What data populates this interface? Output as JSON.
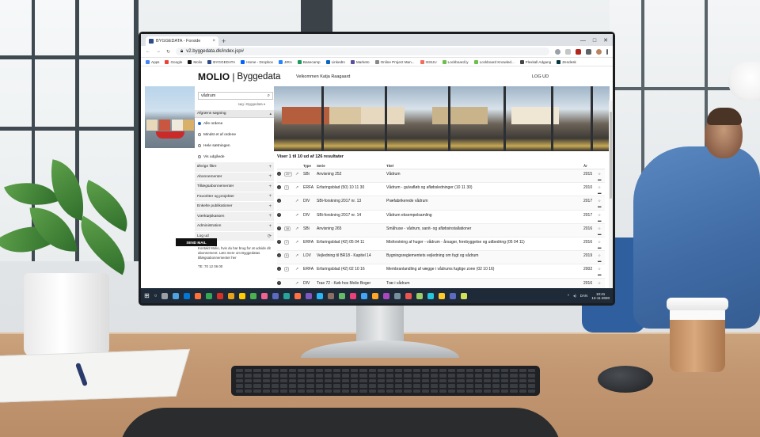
{
  "browser": {
    "tab_title": "BYGGEDATA - Forside",
    "tab_close": "×",
    "new_tab": "+",
    "window_controls": [
      "—",
      "□",
      "✕"
    ],
    "url": "v2.byggedata.dk/index.jsp#",
    "nav": {
      "back": "←",
      "forward": "→",
      "reload": "↻"
    },
    "bookmarks": [
      {
        "label": "Apps",
        "color": "#4285f4"
      },
      {
        "label": "Google",
        "color": "#ea4335"
      },
      {
        "label": "Molio",
        "color": "#111111"
      },
      {
        "label": "BYGGEDATA",
        "color": "#2d4a8a"
      },
      {
        "label": "Home - Dropbox",
        "color": "#0061fe"
      },
      {
        "label": "JIRA",
        "color": "#2684ff"
      },
      {
        "label": "Basecamp",
        "color": "#1d9a5a"
      },
      {
        "label": "LinkedIn",
        "color": "#0a66c2"
      },
      {
        "label": "Marketo",
        "color": "#5c4c9f"
      },
      {
        "label": "Online Project Man...",
        "color": "#888888"
      },
      {
        "label": "ISSUU",
        "color": "#f36d5d"
      },
      {
        "label": "Lockboard.ly",
        "color": "#6dbf4b"
      },
      {
        "label": "Lockboard Knowled...",
        "color": "#6dbf4b"
      },
      {
        "label": "Flexkall Adgang",
        "color": "#444444"
      },
      {
        "label": "Zendesk",
        "color": "#03363d"
      }
    ]
  },
  "site": {
    "logo": "MOLIO",
    "logo_sep": "|",
    "logo_sub": "Byggedata",
    "welcome": "Velkommen Katja Raagaard",
    "logout": "LOG UD"
  },
  "search": {
    "value": "vådrum",
    "icon": "search-icon",
    "hint": "søg i Byggedata  ▾"
  },
  "sidebar": {
    "filter_head": "Afgræns søgning",
    "radios": [
      {
        "label": "Alle ordene",
        "checked": true
      },
      {
        "label": "Mindst et af ordene",
        "checked": false
      },
      {
        "label": "Hele sætningen",
        "checked": false
      },
      {
        "label": "Vis udgåede",
        "checked": false
      }
    ],
    "items": [
      {
        "label": "Øvrige filtre",
        "icon": "+"
      },
      {
        "label": "Abonnementer",
        "icon": "+"
      },
      {
        "label": "Tillægsabonnementer",
        "icon": "+"
      },
      {
        "label": "Favoritter og projekter",
        "icon": "+"
      },
      {
        "label": "Enkelte publikationer",
        "icon": "+"
      },
      {
        "label": "Værktøjskassen",
        "icon": "+"
      },
      {
        "label": "Administration",
        "icon": "+"
      },
      {
        "label": "Log ud",
        "icon": "⟳"
      }
    ],
    "contact_text": "Kontakt Molio, hvis du har brug for at udvide dit abonnement. Læs mere om Byggedatas tillægsabonnementer her",
    "phone": "TE: 70 12 06 00",
    "send_mail": "SEND MAIL"
  },
  "results": {
    "count_text": "Viser 1 til 10 ud af 126 resultater",
    "columns": {
      "type": "Type",
      "serie": "Serie",
      "titel": "Titel",
      "aar": "År"
    },
    "rows": [
      {
        "badge": "20+",
        "type": "SBi",
        "serie": "Anvisning 252",
        "titel": "Vådrum",
        "aar": "2015"
      },
      {
        "badge": "2",
        "type": "ERFA",
        "serie": "Erfaringsblad (50) 10 11 30",
        "titel": "Vådrum - gulvafløb og afløbsledninger (10 11 30)",
        "aar": "2010"
      },
      {
        "badge": "",
        "type": "DIV",
        "serie": "SBi-forskning 2017 nr. 13",
        "titel": "Præfabrikerede vådrum",
        "aar": "2017"
      },
      {
        "badge": "",
        "type": "DIV",
        "serie": "SBi-forskning 2017 nr. 14",
        "titel": "Vådrum eksempelsamling",
        "aar": "2017"
      },
      {
        "badge": "38",
        "type": "SBi",
        "serie": "Anvisning 265",
        "titel": "Småhuse - vådrum, sanit- og afløbsinstallationer",
        "aar": "2016"
      },
      {
        "badge": "2",
        "type": "ERFA",
        "serie": "Erfaringsblad (42) 05 04 11",
        "titel": "Misforstning af huger - vådrum - årsager, forebyggelse og udbedring (05 04 11)",
        "aar": "2016"
      },
      {
        "badge": "5",
        "type": "LOV",
        "serie": "Vejledning til BR18 - Kapitel 14",
        "titel": "Bygningsreglementets vejledning om fugt og vådrum",
        "aar": "2019"
      },
      {
        "badge": "2",
        "type": "ERFA",
        "serie": "Erfaringsblad (42) 02 10 16",
        "titel": "Membranlandling af vægge i vådrums fugtige zone (02 10 16)",
        "aar": "2002"
      },
      {
        "badge": "",
        "type": "DIV",
        "serie": "Trae 72 - Køb hos Molio Boger",
        "titel": "Træ i vådrum",
        "aar": "2016"
      }
    ]
  },
  "taskbar": {
    "start_icon": "windows-icon",
    "tray": [
      "^",
      "◂)",
      "DAN"
    ],
    "time": "10:41",
    "date": "13-11-2020",
    "icon_colors": [
      "#9aa0a6",
      "#4fa3e0",
      "#0078d4",
      "#ff7139",
      "#34a853",
      "#d93025",
      "#e8a317",
      "#ffcc00",
      "#4caf50",
      "#f06292",
      "#5c6bc0",
      "#26a69a",
      "#ff7043",
      "#7e57c2",
      "#29b6f6",
      "#8d6e63",
      "#66bb6a",
      "#ec407a",
      "#42a5f5",
      "#ffa726",
      "#ab47bc",
      "#78909c",
      "#ef5350",
      "#9ccc65",
      "#26c6da",
      "#ffca28",
      "#5c6bc0",
      "#d4e157"
    ]
  }
}
